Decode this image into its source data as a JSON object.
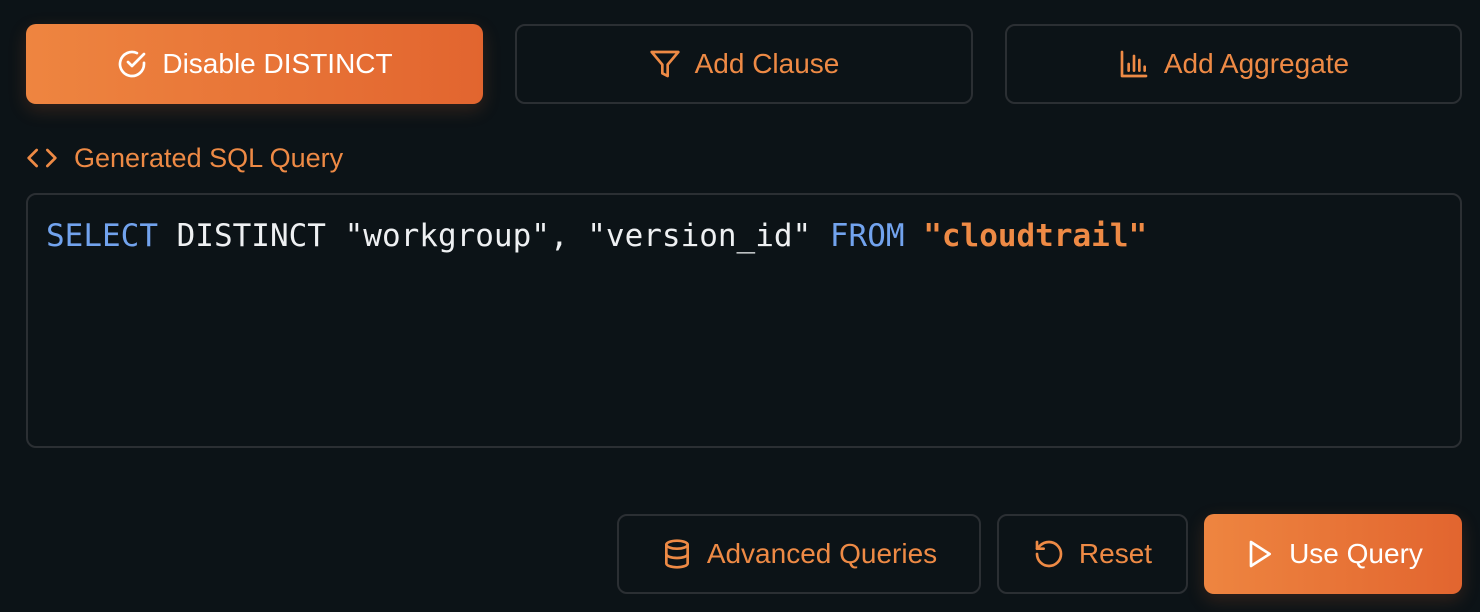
{
  "toolbar": {
    "disable_distinct_label": "Disable DISTINCT",
    "add_clause_label": "Add Clause",
    "add_aggregate_label": "Add Aggregate"
  },
  "query_section": {
    "title": "Generated SQL Query"
  },
  "query": {
    "kw_select": "SELECT",
    "distinct_and_columns": " DISTINCT \"workgroup\", \"version_id\" ",
    "kw_from": "FROM",
    "space": " ",
    "table": "\"cloudtrail\""
  },
  "footer": {
    "advanced_label": "Advanced Queries",
    "reset_label": "Reset",
    "use_query_label": "Use Query"
  },
  "colors": {
    "accent": "#ee8a45",
    "primary_gradient_start": "#ee8540",
    "primary_gradient_end": "#e2652f",
    "keyword": "#72a3ee",
    "background": "#0c1317",
    "border": "#2b2f33"
  },
  "icons": {
    "disable_distinct": "check-circle-icon",
    "add_clause": "filter-icon",
    "add_aggregate": "bar-chart-icon",
    "section": "code-brackets-icon",
    "advanced": "database-icon",
    "reset": "rotate-ccw-icon",
    "use_query": "play-icon"
  }
}
